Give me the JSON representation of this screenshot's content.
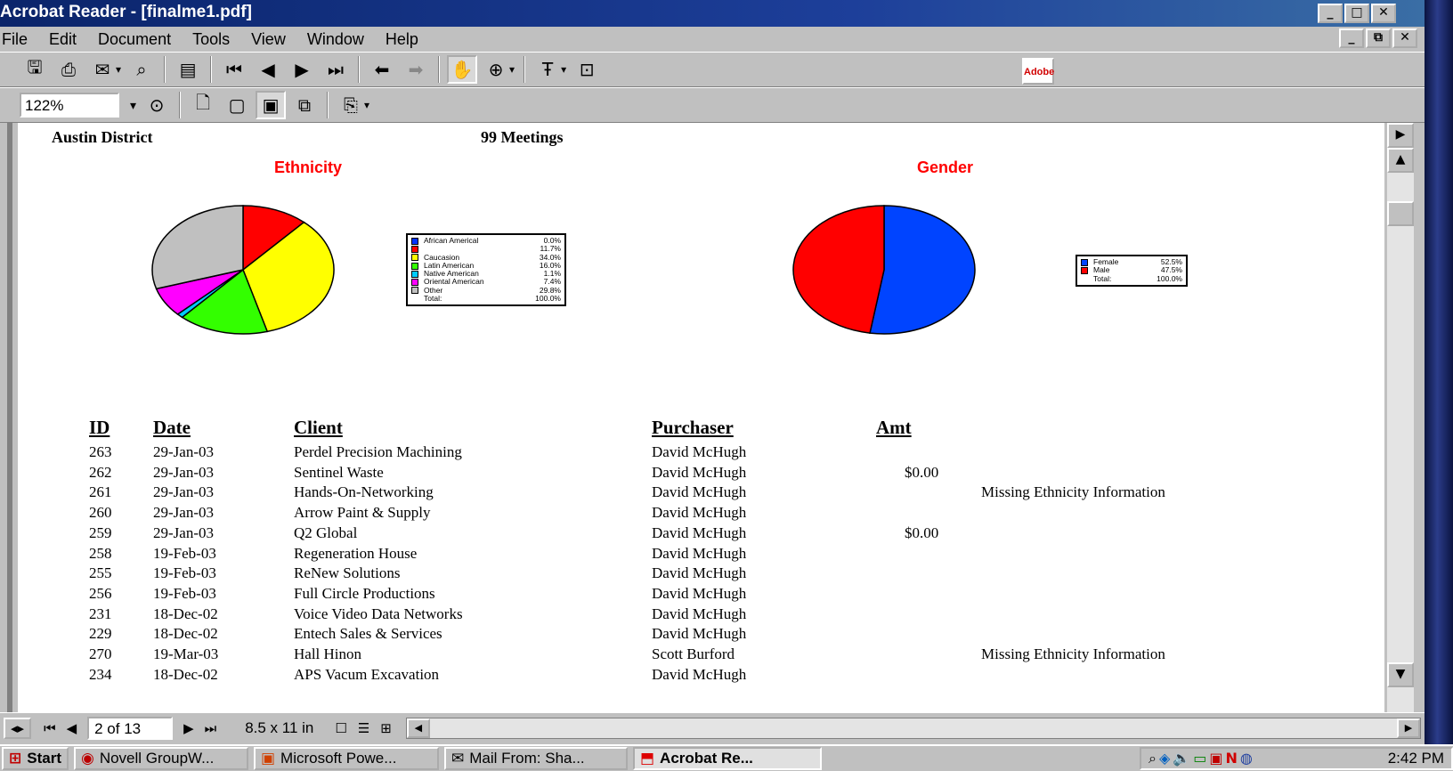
{
  "window": {
    "title": "Acrobat Reader - [finalme1.pdf]",
    "controls": [
      "_",
      "□",
      "✕"
    ],
    "doc_controls": [
      "_",
      "⧉",
      "✕"
    ]
  },
  "menu": [
    "File",
    "Edit",
    "Document",
    "Tools",
    "View",
    "Window",
    "Help"
  ],
  "toolbar": {
    "zoom_value": "122%",
    "adobe_label": "Adobe"
  },
  "document": {
    "district": "Austin District",
    "meetings": "99  Meetings",
    "ethnicity_chart": {
      "title": "Ethnicity",
      "legend": [
        {
          "label": "African Americal",
          "value": "0.0%"
        },
        {
          "label": "",
          "value": "11.7%"
        },
        {
          "label": "Caucasion",
          "value": "34.0%"
        },
        {
          "label": "Latin American",
          "value": "16.0%"
        },
        {
          "label": "Native American",
          "value": "1.1%"
        },
        {
          "label": "Oriental American",
          "value": "7.4%"
        },
        {
          "label": "Other",
          "value": "29.8%"
        }
      ],
      "legend_total": {
        "label": "Total:",
        "value": "100.0%"
      }
    },
    "gender_chart": {
      "title": "Gender",
      "legend": [
        {
          "label": "Female",
          "value": "52.5%"
        },
        {
          "label": "Male",
          "value": "47.5%"
        }
      ],
      "legend_total": {
        "label": "Total:",
        "value": "100.0%"
      }
    },
    "columns": {
      "id": "ID",
      "date": "Date",
      "client": "Client",
      "purchaser": "Purchaser",
      "amt": "Amt"
    },
    "rows": [
      {
        "id": "263",
        "date": "29-Jan-03",
        "client": "Perdel Precision Machining",
        "purchaser": "David McHugh",
        "amt": "",
        "note": ""
      },
      {
        "id": "262",
        "date": "29-Jan-03",
        "client": "Sentinel Waste",
        "purchaser": "David McHugh",
        "amt": "$0.00",
        "note": ""
      },
      {
        "id": "261",
        "date": "29-Jan-03",
        "client": "Hands-On-Networking",
        "purchaser": "David McHugh",
        "amt": "",
        "note": "Missing Ethnicity Information"
      },
      {
        "id": "260",
        "date": "29-Jan-03",
        "client": "Arrow Paint & Supply",
        "purchaser": "David McHugh",
        "amt": "",
        "note": ""
      },
      {
        "id": "259",
        "date": "29-Jan-03",
        "client": "Q2 Global",
        "purchaser": "David McHugh",
        "amt": "$0.00",
        "note": ""
      },
      {
        "id": "258",
        "date": "19-Feb-03",
        "client": "Regeneration House",
        "purchaser": "David McHugh",
        "amt": "",
        "note": ""
      },
      {
        "id": "255",
        "date": "19-Feb-03",
        "client": "ReNew Solutions",
        "purchaser": "David McHugh",
        "amt": "",
        "note": ""
      },
      {
        "id": "256",
        "date": "19-Feb-03",
        "client": "Full Circle Productions",
        "purchaser": "David McHugh",
        "amt": "",
        "note": ""
      },
      {
        "id": "231",
        "date": "18-Dec-02",
        "client": "Voice Video Data Networks",
        "purchaser": "David McHugh",
        "amt": "",
        "note": ""
      },
      {
        "id": "229",
        "date": "18-Dec-02",
        "client": "Entech Sales & Services",
        "purchaser": "David McHugh",
        "amt": "",
        "note": ""
      },
      {
        "id": "270",
        "date": "19-Mar-03",
        "client": "Hall Hinon",
        "purchaser": "Scott Burford",
        "amt": "",
        "note": "Missing Ethnicity Information"
      },
      {
        "id": "234",
        "date": "18-Dec-02",
        "client": "APS Vacum Excavation",
        "purchaser": "David McHugh",
        "amt": "",
        "note": ""
      }
    ]
  },
  "chart_data": [
    {
      "type": "pie",
      "title": "Ethnicity",
      "categories": [
        "African Americal",
        "",
        "Caucasion",
        "Latin American",
        "Native American",
        "Oriental American",
        "Other"
      ],
      "values": [
        0.0,
        11.7,
        34.0,
        16.0,
        1.1,
        7.4,
        29.8
      ],
      "colors": [
        "#0033ff",
        "#ff0000",
        "#ffff00",
        "#33ff00",
        "#00ccff",
        "#ff00ff",
        "#c0c0c0"
      ],
      "legend": "right"
    },
    {
      "type": "pie",
      "title": "Gender",
      "categories": [
        "Female",
        "Male"
      ],
      "values": [
        52.5,
        47.5
      ],
      "colors": [
        "#0044ff",
        "#ff0000"
      ],
      "legend": "right"
    }
  ],
  "navbar": {
    "page_field": "2 of 13",
    "page_size": "8.5 x 11 in"
  },
  "taskbar": {
    "start": "Start",
    "tasks": [
      "Novell GroupW...",
      "Microsoft Powe...",
      "Mail From: Sha...",
      "Acrobat Re..."
    ],
    "clock": "2:42 PM"
  }
}
